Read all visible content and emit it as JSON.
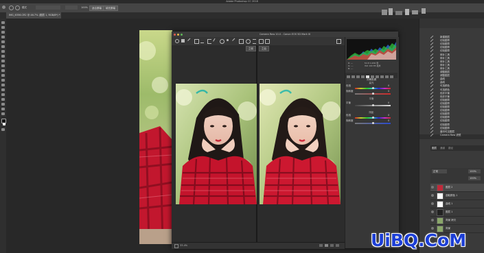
{
  "app": {
    "title": "Adobe Photoshop CC 2018"
  },
  "options_bar": {
    "mode_label": "模式",
    "zoom": "100%",
    "fit_button": "适合屏幕",
    "fill_button": "填充屏幕"
  },
  "document": {
    "tab_label": "IMG_6356.CR2 @ 46.7% (图层 1, RGB/8*) *"
  },
  "camera_raw": {
    "title": "Camera Raw 10.0 - Canon EOS 5D Mark III",
    "before_label": "之前",
    "after_label": "之后",
    "zoom": "33.4%",
    "histogram_readout": {
      "r": "R: ---",
      "g": "G: ---",
      "b": "B: ---",
      "meta1": "f/2.8   1/200 秒",
      "meta2": "ISO 100   85 毫米"
    },
    "panel_title": "分离色调",
    "sections": {
      "highlights": "高光",
      "balance": "平衡",
      "shadows": "阴影"
    },
    "sliders": [
      {
        "label": "色相",
        "value": "0",
        "pos": 0.5
      },
      {
        "label": "饱和度",
        "value": "0",
        "pos": 0.5
      },
      {
        "label": "平衡",
        "value": "0",
        "pos": 0.5
      },
      {
        "label": "色相",
        "value": "0",
        "pos": 0.5
      },
      {
        "label": "饱和度",
        "value": "0",
        "pos": 0.5
      }
    ],
    "colors": {
      "accent": "#5aa0e6",
      "hue_gradient_1": "#cc2a2a",
      "hue_gradient_2": "#2a8a3a",
      "hue_gradient_3": "#2a4acc"
    }
  },
  "history": {
    "items": [
      "新建图层",
      "仿制图章",
      "仿制图章",
      "仿制图章",
      "仿制图章",
      "修补工具",
      "修补工具",
      "修补工具",
      "修补工具",
      "修补工具",
      "调整图层",
      "调整图层",
      "曲线",
      "曲线",
      "可选颜色",
      "可选颜色",
      "色彩平衡",
      "色彩平衡",
      "仿制图章",
      "仿制图章",
      "仿制图章",
      "仿制图章",
      "仿制图章",
      "仿制图章",
      "仿制图章",
      "仿制图章",
      "仿制图章",
      "盖印可见图层",
      "Camera Raw 滤镜"
    ]
  },
  "layers_panel": {
    "tabs": [
      "图层",
      "通道",
      "路径"
    ],
    "blend_mode": "正常",
    "opacity": "100%",
    "fill": "100%",
    "layers": [
      {
        "name": "图层 2"
      },
      {
        "name": "选取颜色 1"
      },
      {
        "name": "曲线 1"
      },
      {
        "name": "图层 1"
      },
      {
        "name": "背景 拷贝"
      },
      {
        "name": "背景"
      }
    ]
  },
  "watermark": "UiBQ.CoM"
}
